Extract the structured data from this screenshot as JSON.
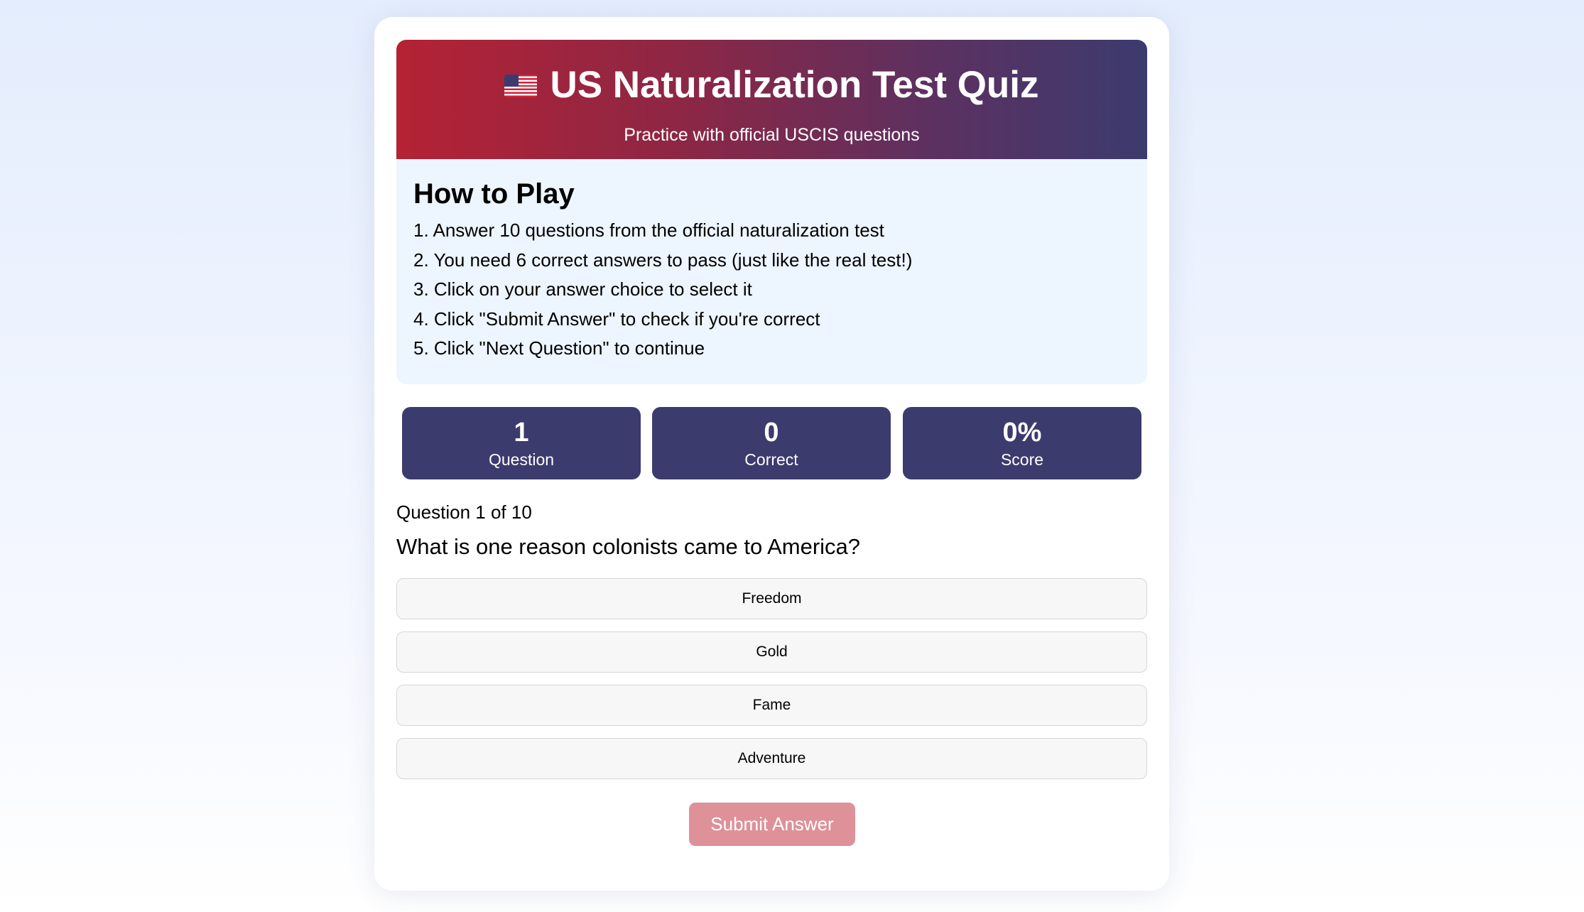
{
  "header": {
    "flag_icon": "us-flag-emoji",
    "title": "US Naturalization Test Quiz",
    "subtitle": "Practice with official USCIS questions"
  },
  "instructions": {
    "title": "How to Play",
    "steps": [
      "1. Answer 10 questions from the official naturalization test",
      "2. You need 6 correct answers to pass (just like the real test!)",
      "3. Click on your answer choice to select it",
      "4. Click \"Submit Answer\" to check if you're correct",
      "5. Click \"Next Question\" to continue"
    ]
  },
  "stats": [
    {
      "value": "1",
      "label": "Question"
    },
    {
      "value": "0",
      "label": "Correct"
    },
    {
      "value": "0%",
      "label": "Score"
    }
  ],
  "quiz": {
    "progress": "Question 1 of 10",
    "question": "What is one reason colonists came to America?",
    "options": [
      "Freedom",
      "Gold",
      "Fame",
      "Adventure"
    ],
    "submit_label": "Submit Answer"
  },
  "colors": {
    "flag_red": "#b52234",
    "navy": "#3c3b6e",
    "instructions_bg": "#edf5fe",
    "submit_disabled": "#de9199"
  }
}
